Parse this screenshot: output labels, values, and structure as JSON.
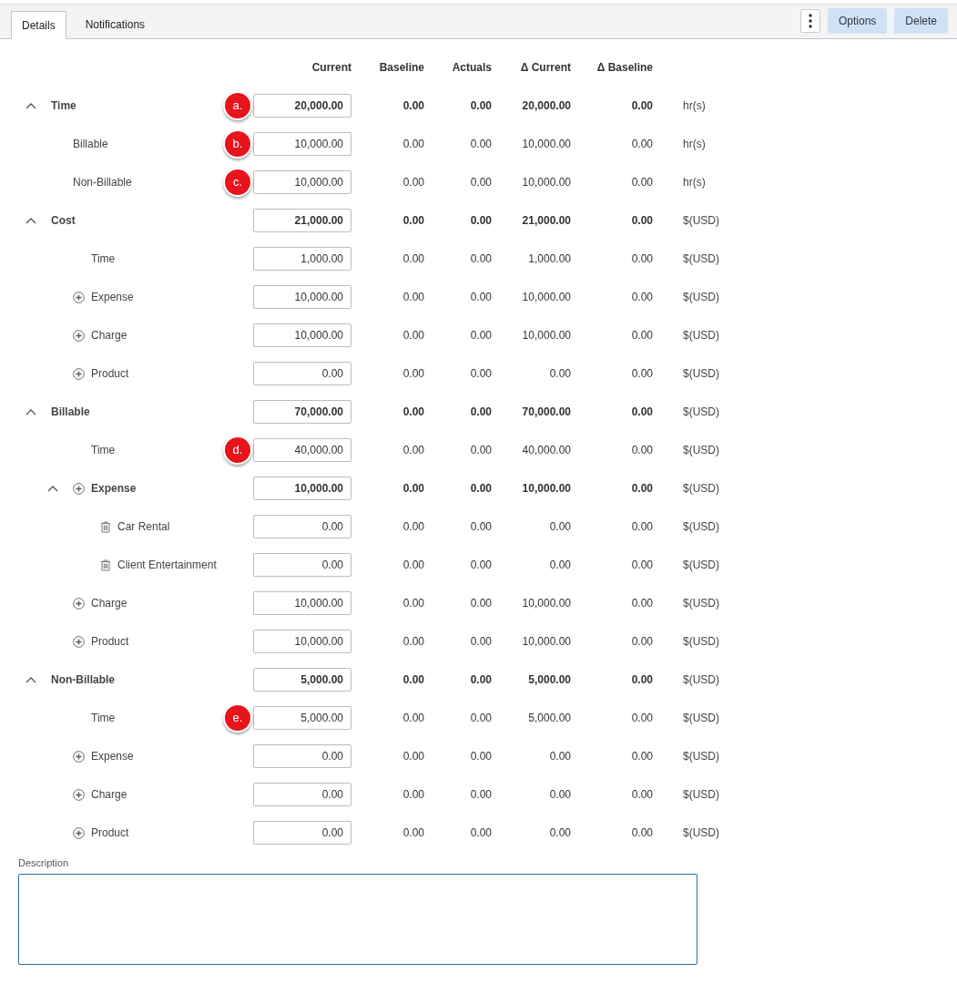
{
  "tabs": [
    {
      "label": "Details",
      "selected": true
    },
    {
      "label": "Notifications",
      "selected": false
    }
  ],
  "actions": [
    "Options",
    "Delete"
  ],
  "columns": [
    "Current",
    "Baseline",
    "Actuals",
    "Δ Current",
    "Δ Baseline"
  ],
  "rows": [
    {
      "label": "Time",
      "expanded": true,
      "current": "20,000.00",
      "marker": "a.",
      "baseline": "0.00",
      "actuals": "0.00",
      "delta_current": "20,000.00",
      "delta_baseline": "0.00",
      "unit": "hr(s)",
      "children": [
        {
          "label": "Billable",
          "kind": "plain",
          "current": "10,000.00",
          "marker": "b.",
          "baseline": "0.00",
          "actuals": "0.00",
          "delta_current": "10,000.00",
          "delta_baseline": "0.00",
          "unit": "hr(s)"
        },
        {
          "label": "Non-Billable",
          "kind": "plain",
          "current": "10,000.00",
          "marker": "c.",
          "baseline": "0.00",
          "actuals": "0.00",
          "delta_current": "10,000.00",
          "delta_baseline": "0.00",
          "unit": "hr(s)"
        }
      ]
    },
    {
      "label": "Cost",
      "expanded": true,
      "current": "21,000.00",
      "baseline": "0.00",
      "actuals": "0.00",
      "delta_current": "21,000.00",
      "delta_baseline": "0.00",
      "unit": "$(USD)",
      "children": [
        {
          "label": "Time",
          "kind": "item",
          "current": "1,000.00",
          "baseline": "0.00",
          "actuals": "0.00",
          "delta_current": "1,000.00",
          "delta_baseline": "0.00",
          "unit": "$(USD)"
        },
        {
          "label": "Expense",
          "kind": "addable",
          "current": "10,000.00",
          "baseline": "0.00",
          "actuals": "0.00",
          "delta_current": "10,000.00",
          "delta_baseline": "0.00",
          "unit": "$(USD)"
        },
        {
          "label": "Charge",
          "kind": "addable",
          "current": "10,000.00",
          "baseline": "0.00",
          "actuals": "0.00",
          "delta_current": "10,000.00",
          "delta_baseline": "0.00",
          "unit": "$(USD)"
        },
        {
          "label": "Product",
          "kind": "addable",
          "current": "0.00",
          "baseline": "0.00",
          "actuals": "0.00",
          "delta_current": "0.00",
          "delta_baseline": "0.00",
          "unit": "$(USD)"
        }
      ]
    },
    {
      "label": "Billable",
      "expanded": true,
      "current": "70,000.00",
      "baseline": "0.00",
      "actuals": "0.00",
      "delta_current": "70,000.00",
      "delta_baseline": "0.00",
      "unit": "$(USD)",
      "children": [
        {
          "label": "Time",
          "kind": "item",
          "current": "40,000.00",
          "marker": "d.",
          "baseline": "0.00",
          "actuals": "0.00",
          "delta_current": "40,000.00",
          "delta_baseline": "0.00",
          "unit": "$(USD)"
        },
        {
          "label": "Expense",
          "kind": "addable",
          "expanded": true,
          "current": "10,000.00",
          "baseline": "0.00",
          "actuals": "0.00",
          "delta_current": "10,000.00",
          "delta_baseline": "0.00",
          "unit": "$(USD)",
          "children": [
            {
              "label": "Car Rental",
              "kind": "deletable",
              "current": "0.00",
              "baseline": "0.00",
              "actuals": "0.00",
              "delta_current": "0.00",
              "delta_baseline": "0.00",
              "unit": "$(USD)"
            },
            {
              "label": "Client Entertainment",
              "kind": "deletable",
              "current": "0.00",
              "baseline": "0.00",
              "actuals": "0.00",
              "delta_current": "0.00",
              "delta_baseline": "0.00",
              "unit": "$(USD)"
            }
          ]
        },
        {
          "label": "Charge",
          "kind": "addable",
          "current": "10,000.00",
          "baseline": "0.00",
          "actuals": "0.00",
          "delta_current": "10,000.00",
          "delta_baseline": "0.00",
          "unit": "$(USD)"
        },
        {
          "label": "Product",
          "kind": "addable",
          "current": "10,000.00",
          "baseline": "0.00",
          "actuals": "0.00",
          "delta_current": "10,000.00",
          "delta_baseline": "0.00",
          "unit": "$(USD)"
        }
      ]
    },
    {
      "label": "Non-Billable",
      "expanded": true,
      "current": "5,000.00",
      "baseline": "0.00",
      "actuals": "0.00",
      "delta_current": "5,000.00",
      "delta_baseline": "0.00",
      "unit": "$(USD)",
      "children": [
        {
          "label": "Time",
          "kind": "item",
          "current": "5,000.00",
          "marker": "e.",
          "baseline": "0.00",
          "actuals": "0.00",
          "delta_current": "5,000.00",
          "delta_baseline": "0.00",
          "unit": "$(USD)"
        },
        {
          "label": "Expense",
          "kind": "addable",
          "current": "0.00",
          "baseline": "0.00",
          "actuals": "0.00",
          "delta_current": "0.00",
          "delta_baseline": "0.00",
          "unit": "$(USD)"
        },
        {
          "label": "Charge",
          "kind": "addable",
          "current": "0.00",
          "baseline": "0.00",
          "actuals": "0.00",
          "delta_current": "0.00",
          "delta_baseline": "0.00",
          "unit": "$(USD)"
        },
        {
          "label": "Product",
          "kind": "addable",
          "current": "0.00",
          "baseline": "0.00",
          "actuals": "0.00",
          "delta_current": "0.00",
          "delta_baseline": "0.00",
          "unit": "$(USD)"
        }
      ]
    }
  ],
  "description": {
    "label": "Description"
  }
}
